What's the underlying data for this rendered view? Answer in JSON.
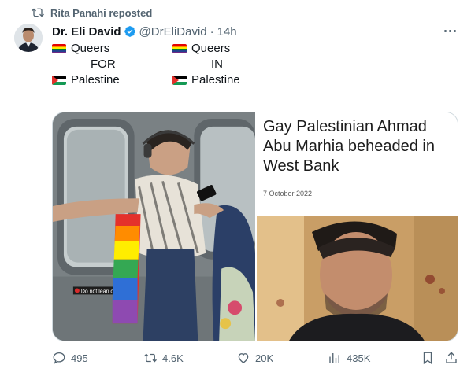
{
  "repost": {
    "label": "Rita Panahi reposted",
    "icon": "repost-icon"
  },
  "author": {
    "name": "Dr. Eli David",
    "handle": "@DrEliDavid",
    "separator": "·",
    "time": "14h",
    "verified_icon": "verified-badge-icon",
    "badge_color": "#1d9bf0"
  },
  "post": {
    "rows": [
      {
        "left": {
          "flag": "rainbow-flag-icon",
          "text": "Queers"
        },
        "right": {
          "flag": "rainbow-flag-icon",
          "text": "Queers"
        }
      },
      {
        "left": {
          "text": "FOR"
        },
        "right": {
          "text": "IN"
        }
      },
      {
        "left": {
          "flag": "palestine-flag-icon",
          "text": "Palestine"
        },
        "right": {
          "flag": "palestine-flag-icon",
          "text": "Palestine"
        }
      }
    ],
    "trailing": "_"
  },
  "media": {
    "left_photo": {
      "sign_text": "Do not lean o"
    },
    "article": {
      "headline": "Gay Palestinian Ahmad Abu Marhia beheaded in West Bank",
      "date": "7 October 2022"
    }
  },
  "actions": {
    "reply": {
      "icon": "reply-icon",
      "count": "495"
    },
    "repost": {
      "icon": "repost-icon",
      "count": "4.6K"
    },
    "like": {
      "icon": "like-icon",
      "count": "20K"
    },
    "views": {
      "icon": "views-icon",
      "count": "435K"
    },
    "bookmark": {
      "icon": "bookmark-icon"
    },
    "share": {
      "icon": "share-icon"
    }
  },
  "colors": {
    "text_primary": "#0f1419",
    "text_secondary": "#536471",
    "border": "#cfd9de"
  }
}
